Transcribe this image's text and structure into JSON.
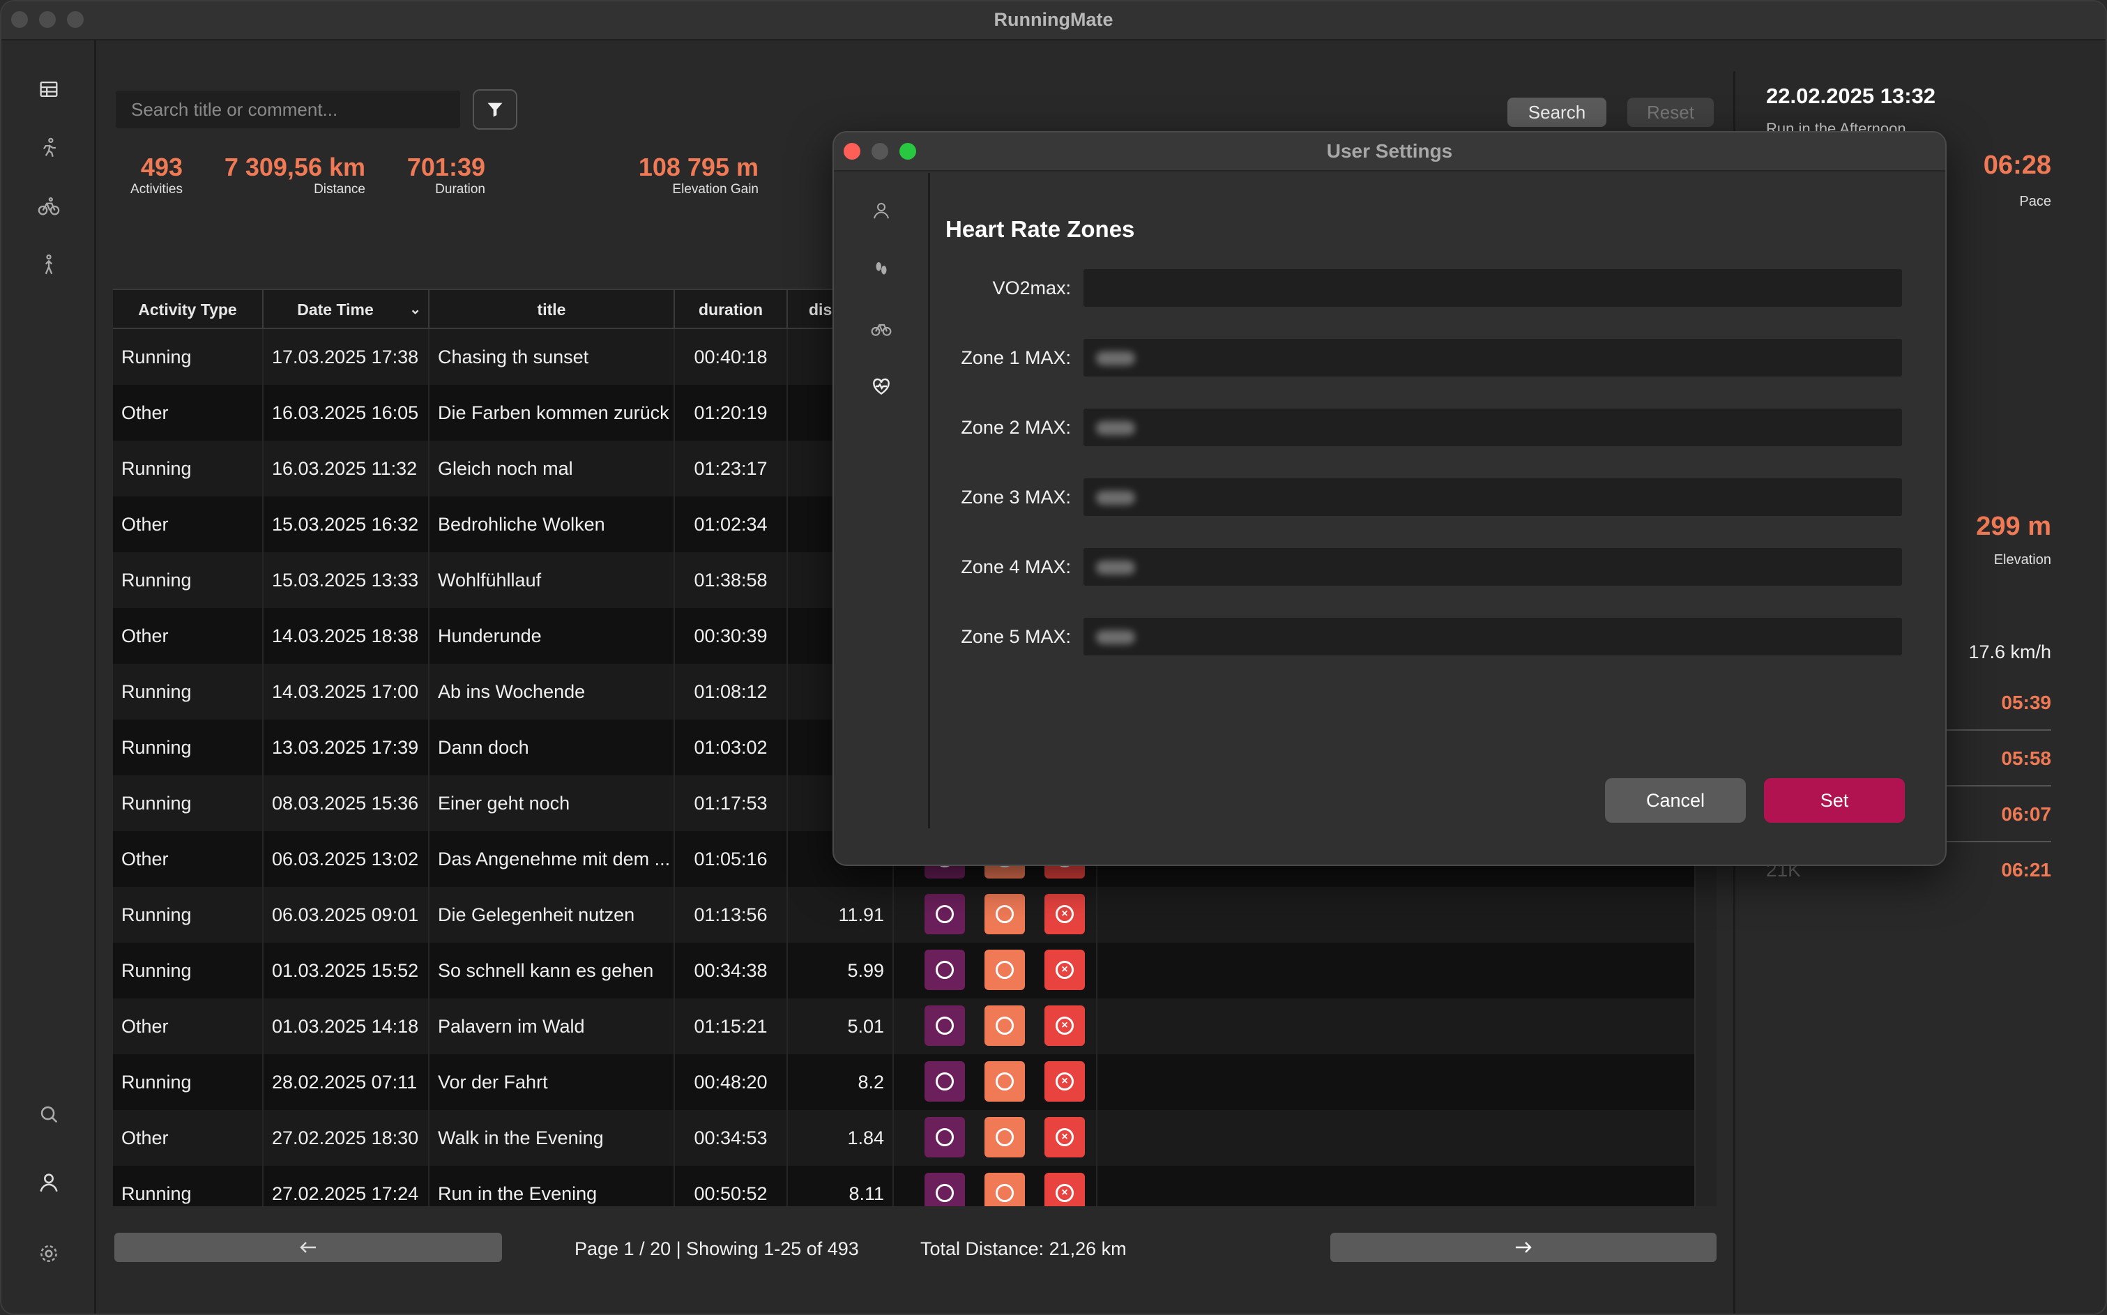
{
  "app": {
    "title": "RunningMate"
  },
  "search": {
    "placeholder": "Search title or comment...",
    "search_label": "Search",
    "reset_label": "Reset"
  },
  "stats": [
    {
      "value": "493",
      "label": "Activities"
    },
    {
      "value": "7 309,56 km",
      "label": "Distance"
    },
    {
      "value": "701:39",
      "label": "Duration"
    },
    {
      "value": "108 795 m",
      "label": "Elevation Gain"
    }
  ],
  "table": {
    "columns": [
      "Activity Type",
      "Date Time",
      "title",
      "duration",
      "dis"
    ],
    "rows": [
      {
        "type": "Running",
        "date": "17.03.2025 17:38",
        "title": "Chasing th sunset",
        "duration": "00:40:18",
        "distance": ""
      },
      {
        "type": "Other",
        "date": "16.03.2025 16:05",
        "title": "Die Farben kommen zurück",
        "duration": "01:20:19",
        "distance": ""
      },
      {
        "type": "Running",
        "date": "16.03.2025 11:32",
        "title": "Gleich noch mal",
        "duration": "01:23:17",
        "distance": ""
      },
      {
        "type": "Other",
        "date": "15.03.2025 16:32",
        "title": "Bedrohliche Wolken",
        "duration": "01:02:34",
        "distance": ""
      },
      {
        "type": "Running",
        "date": "15.03.2025 13:33",
        "title": "Wohlfühllauf",
        "duration": "01:38:58",
        "distance": ""
      },
      {
        "type": "Other",
        "date": "14.03.2025 18:38",
        "title": "Hunderunde",
        "duration": "00:30:39",
        "distance": ""
      },
      {
        "type": "Running",
        "date": "14.03.2025 17:00",
        "title": "Ab ins Wochende",
        "duration": "01:08:12",
        "distance": ""
      },
      {
        "type": "Running",
        "date": "13.03.2025 17:39",
        "title": "Dann doch",
        "duration": "01:03:02",
        "distance": ""
      },
      {
        "type": "Running",
        "date": "08.03.2025 15:36",
        "title": "Einer geht noch",
        "duration": "01:17:53",
        "distance": ""
      },
      {
        "type": "Other",
        "date": "06.03.2025 13:02",
        "title": "Das Angenehme mit dem ...",
        "duration": "01:05:16",
        "distance": ""
      },
      {
        "type": "Running",
        "date": "06.03.2025 09:01",
        "title": "Die Gelegenheit nutzen",
        "duration": "01:13:56",
        "distance": "11.91"
      },
      {
        "type": "Running",
        "date": "01.03.2025 15:52",
        "title": "So schnell kann es gehen",
        "duration": "00:34:38",
        "distance": "5.99"
      },
      {
        "type": "Other",
        "date": "01.03.2025 14:18",
        "title": "Palavern im Wald",
        "duration": "01:15:21",
        "distance": "5.01"
      },
      {
        "type": "Running",
        "date": "28.02.2025 07:11",
        "title": "Vor der Fahrt",
        "duration": "00:48:20",
        "distance": "8.2"
      },
      {
        "type": "Other",
        "date": "27.02.2025 18:30",
        "title": "Walk in the Evening",
        "duration": "00:34:53",
        "distance": "1.84"
      },
      {
        "type": "Running",
        "date": "27.02.2025 17:24",
        "title": "Run in the Evening",
        "duration": "00:50:52",
        "distance": "8.11"
      }
    ]
  },
  "footer": {
    "page_info": "Page 1 / 20 | Showing 1-25 of 493",
    "total_distance": "Total Distance: 21,26 km"
  },
  "right_panel": {
    "date": "22.02.2025 13:32",
    "subtitle": "Run in the Afternoon",
    "pace_value": "06:28",
    "pace_label": "Pace",
    "elevation_value": "299 m",
    "elevation_label": "Elevation",
    "speed": "17.6 km/h",
    "splits": [
      {
        "label": "",
        "value": "05:39"
      },
      {
        "label": "",
        "value": "05:58"
      },
      {
        "label": "",
        "value": "06:07"
      },
      {
        "label": "21K",
        "value": "06:21"
      }
    ]
  },
  "dialog": {
    "title": "User Settings",
    "heading": "Heart Rate Zones",
    "fields": [
      "VO2max:",
      "Zone 1 MAX:",
      "Zone 2 MAX:",
      "Zone 3 MAX:",
      "Zone 4 MAX:",
      "Zone 5 MAX:"
    ],
    "cancel_label": "Cancel",
    "set_label": "Set"
  },
  "colors": {
    "accent": "#f07a56",
    "set_button": "#b0134f",
    "strava": "#6b1f5b",
    "garmin": "#f07a56",
    "delete": "#e8433f"
  }
}
